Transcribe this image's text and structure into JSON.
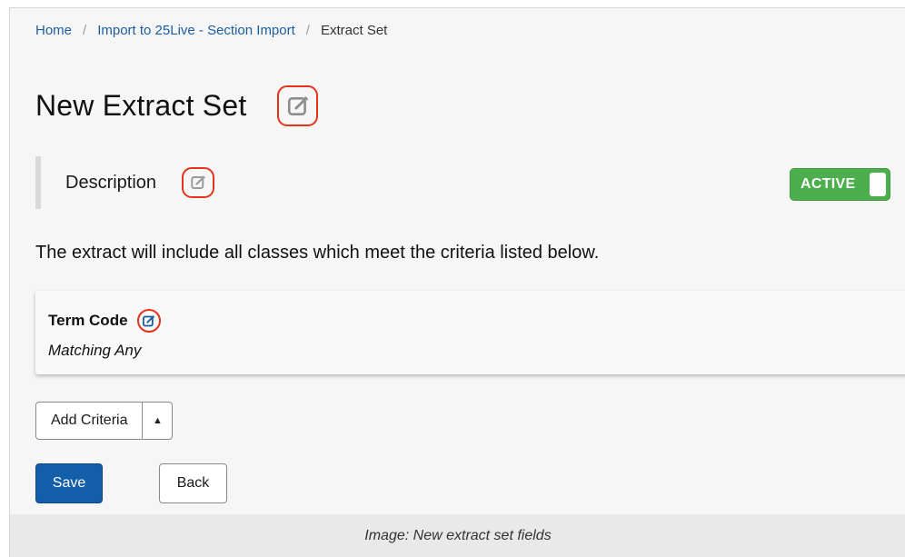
{
  "breadcrumb": {
    "home": "Home",
    "section": "Import to 25Live - Section Import",
    "current": "Extract Set",
    "separator": "/"
  },
  "page": {
    "title": "New Extract Set",
    "title_edit_icon": "edit-pencil-square-icon"
  },
  "description": {
    "label": "Description",
    "edit_icon": "edit-pencil-square-icon",
    "status_toggle": {
      "label": "ACTIVE",
      "on": true,
      "color": "#4cae4c"
    }
  },
  "info_text": "The extract will include all classes which meet the criteria listed below.",
  "criteria": [
    {
      "name": "Term Code",
      "match": "Matching Any",
      "edit_icon": "edit-pencil-square-icon"
    }
  ],
  "actions": {
    "add_criteria": "Add Criteria",
    "add_criteria_caret": "▲",
    "save": "Save",
    "back": "Back"
  },
  "caption": "Image: New extract set fields",
  "colors": {
    "link": "#1c5c9e",
    "primary": "#135ea8",
    "highlight": "#e4321b",
    "active": "#4cae4c"
  }
}
